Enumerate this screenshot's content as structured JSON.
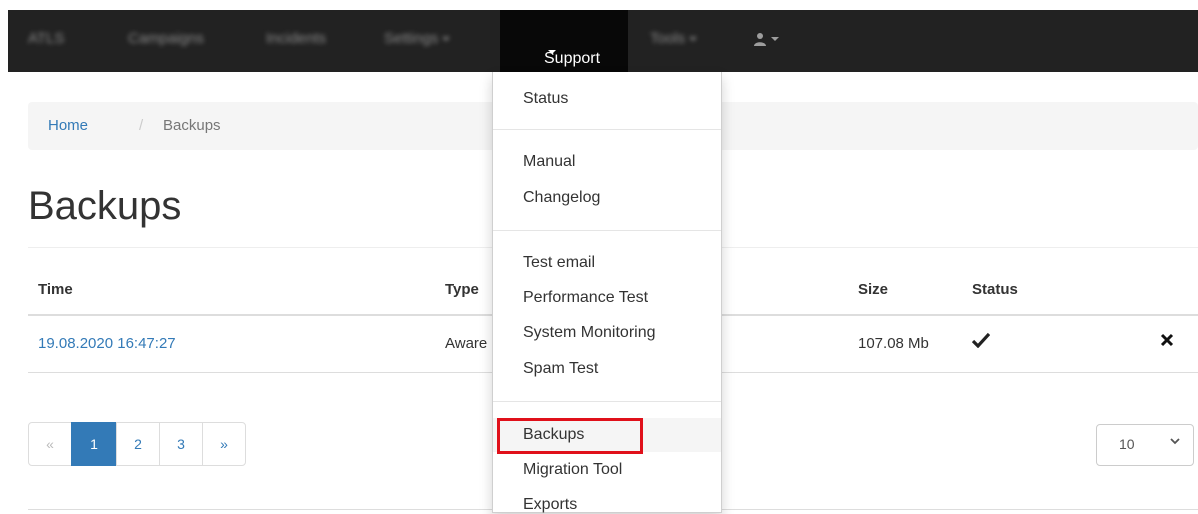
{
  "navbar": {
    "brand": "ATLS",
    "items": [
      {
        "label": "Campaigns"
      },
      {
        "label": "Incidents"
      },
      {
        "label": "Settings"
      },
      {
        "label": "Support"
      },
      {
        "label": "Tools"
      }
    ],
    "user_icon": "user-icon"
  },
  "breadcrumb": {
    "home": "Home",
    "separator": "/",
    "current": "Backups"
  },
  "page": {
    "title": "Backups"
  },
  "table": {
    "headers": [
      "Time",
      "Type",
      "Size",
      "Status"
    ],
    "rows": [
      {
        "time": "19.08.2020 16:47:27",
        "type": "Aware",
        "size": "107.08 Mb",
        "status_icon": "check-icon",
        "delete_icon": "close-icon"
      }
    ]
  },
  "pagination": {
    "prev": "«",
    "pages": [
      "1",
      "2",
      "3"
    ],
    "next": "»",
    "current_page": 1
  },
  "per_page": {
    "selected": "10"
  },
  "support_menu": {
    "items": [
      {
        "label": "Status"
      },
      {
        "label": "Manual"
      },
      {
        "label": "Changelog"
      },
      {
        "label": "Test email"
      },
      {
        "label": "Performance Test"
      },
      {
        "label": "System Monitoring"
      },
      {
        "label": "Spam Test"
      },
      {
        "label": "Backups"
      },
      {
        "label": "Migration Tool"
      },
      {
        "label": "Exports"
      }
    ],
    "highlighted": "Backups",
    "highlight_color": "#e0101a"
  },
  "colors": {
    "navbar_bg": "#222222",
    "link": "#337ab7",
    "active_page": "#337ab7"
  }
}
